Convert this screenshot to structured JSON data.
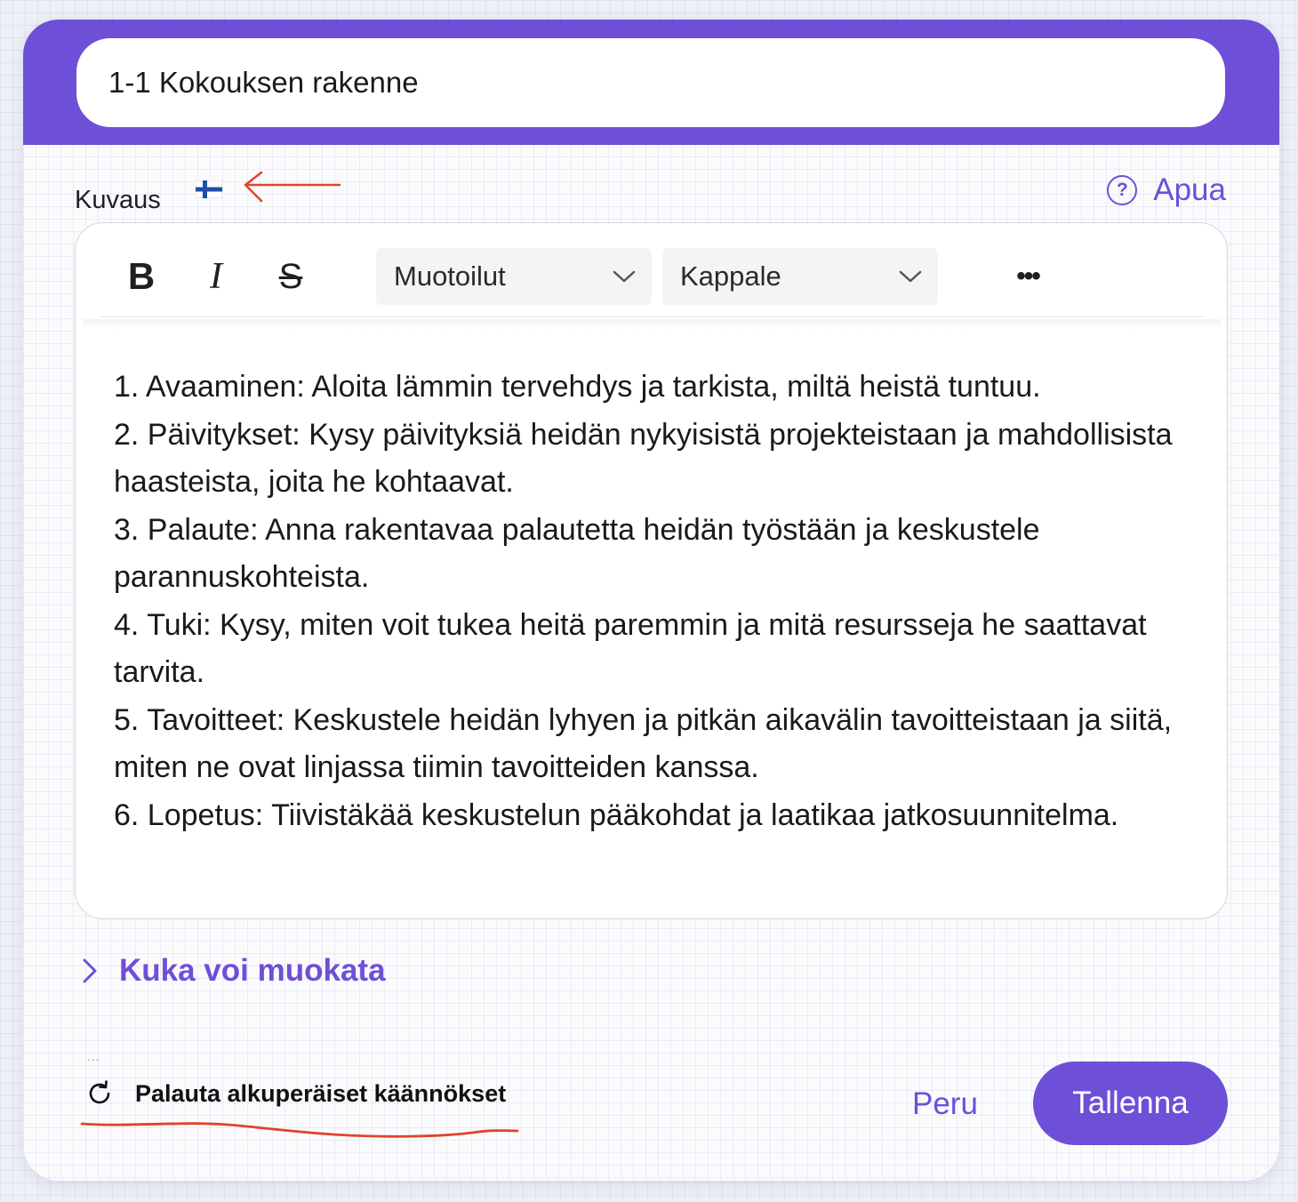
{
  "header": {
    "title_value": "1-1 Kokouksen rakenne",
    "accent_color": "#6e4fd8"
  },
  "description": {
    "label": "Kuvaus",
    "language_flag_icon": "finland-flag-icon",
    "annotation_arrow_color": "#e0442c"
  },
  "help": {
    "icon": "question-circle-icon",
    "label": "Apua"
  },
  "toolbar": {
    "bold_label": "B",
    "italic_label": "I",
    "strike_label": "S",
    "formats_label": "Muotoilut",
    "block_label": "Kappale",
    "more_label": "•••"
  },
  "editor": {
    "lines": [
      "1. Avaaminen: Aloita lämmin tervehdys ja tarkista, miltä heistä tuntuu.",
      "2. Päivitykset: Kysy päivityksiä heidän nykyisistä projekteistaan ja mahdollisista haasteista, joita he kohtaavat.",
      "3. Palaute: Anna rakentavaa palautetta heidän työstään ja keskustele parannuskohteista.",
      "4. Tuki: Kysy, miten voit tukea heitä paremmin ja mitä resursseja he saattavat tarvita.",
      "5. Tavoitteet: Keskustele heidän lyhyen ja pitkän aikavälin tavoitteistaan ja siitä, miten ne ovat linjassa tiimin tavoitteiden kanssa.",
      "6. Lopetus: Tiivistäkää keskustelun pääkohdat ja laatikaa jatkosuunnitelma."
    ]
  },
  "permissions": {
    "label": "Kuka voi muokata",
    "icon": "chevron-right-icon"
  },
  "footer": {
    "dots": "...",
    "restore_icon": "refresh-icon",
    "restore_label": "Palauta alkuperäiset käännökset",
    "cancel_label": "Peru",
    "save_label": "Tallenna"
  }
}
